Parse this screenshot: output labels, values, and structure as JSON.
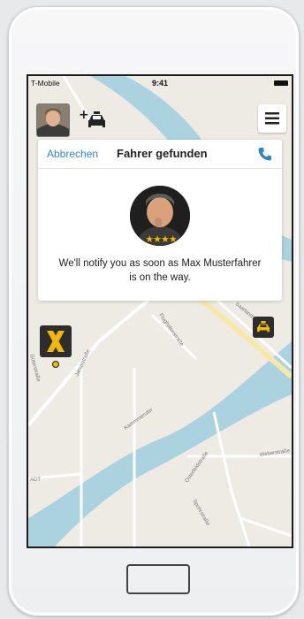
{
  "statusbar": {
    "carrier": "T-Mobile",
    "time": "9:41"
  },
  "card": {
    "cancel_label": "Abbrechen",
    "title": "Fahrer gefunden",
    "message": "We'll notify you as soon as Max Musterfahrer is on the way."
  },
  "driver": {
    "rating": 4
  },
  "map": {
    "streets": [
      "Saarlandstraße",
      "Flughafenstraße",
      "Kammmerufer",
      "Weberstraße",
      "Osterfeldstraße",
      "Spohrstraße",
      "Janusstraße",
      "Güterstraße",
      "ADT"
    ]
  },
  "colors": {
    "accent": "#2e86c9",
    "marker": "#f5b800",
    "water": "#aad3df",
    "map": "#eeebe4"
  }
}
